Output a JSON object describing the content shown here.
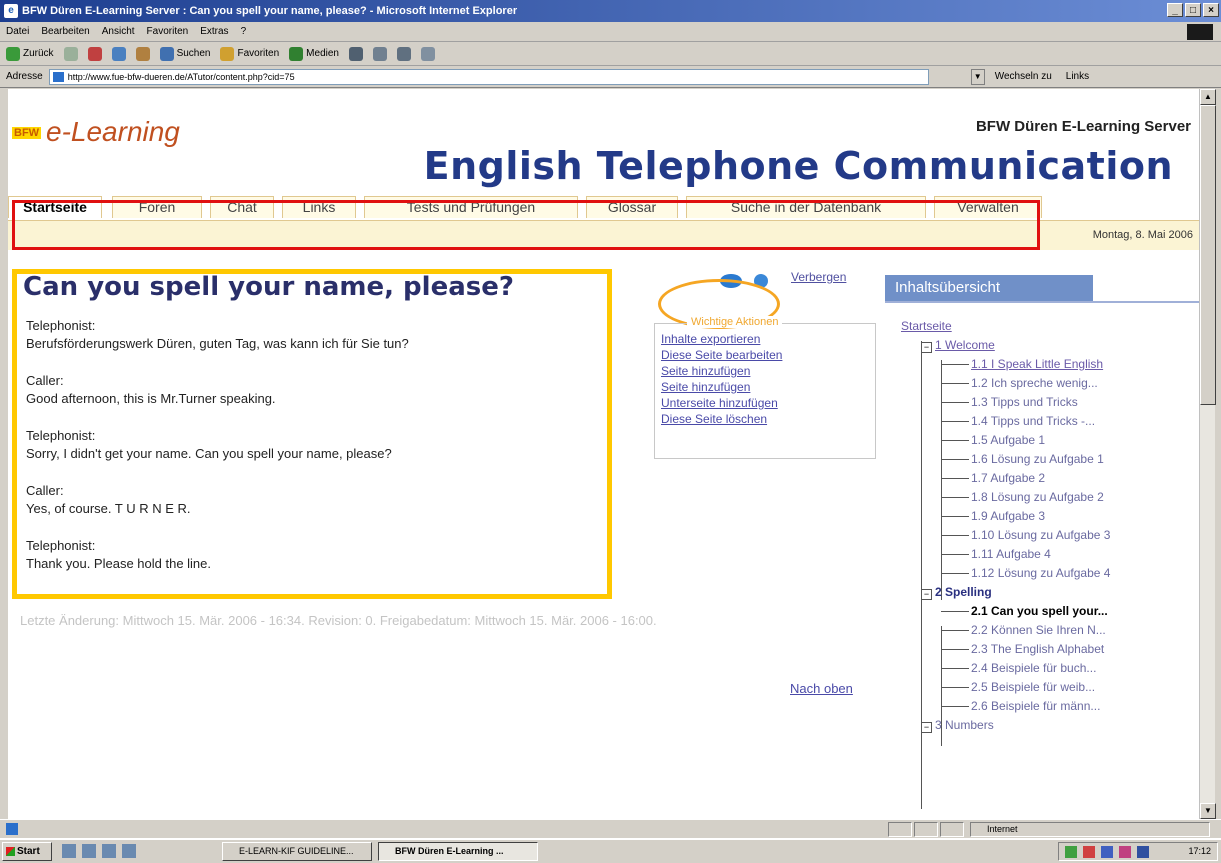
{
  "window": {
    "title": "BFW Düren E-Learning Server : Can you spell your name, please? - Microsoft Internet Explorer"
  },
  "menubar": [
    "Datei",
    "Bearbeiten",
    "Ansicht",
    "Favoriten",
    "Extras",
    "?"
  ],
  "toolbar": {
    "back": "Zurück",
    "search": "Suchen",
    "favorites": "Favoriten",
    "media": "Medien"
  },
  "addressbar": {
    "label": "Adresse",
    "url": "http://www.fue-bfw-dueren.de/ATutor/content.php?cid=75",
    "go": "Wechseln zu",
    "links": "Links"
  },
  "header": {
    "bfw_logo": "BFW",
    "elearning": "e-Learning",
    "server_title": "BFW Düren E-Learning Server",
    "course_title": "English Telephone Communication"
  },
  "nav": {
    "tabs": [
      "Startseite",
      "Foren",
      "Chat",
      "Links",
      "Tests und Prüfungen",
      "Glossar",
      "Suche in der Datenbank",
      "Verwalten"
    ],
    "date": "Montag, 8. Mai 2006"
  },
  "content": {
    "heading": "Can you spell your name, please?",
    "dialog": [
      {
        "speaker": "Telephonist:",
        "text": "Berufsförderungswerk Düren, guten Tag, was kann ich für Sie tun?"
      },
      {
        "speaker": "Caller:",
        "text": "Good afternoon, this is Mr.Turner speaking."
      },
      {
        "speaker": "Telephonist:",
        "text": "Sorry, I didn't get your name. Can you spell your name, please?"
      },
      {
        "speaker": "Caller:",
        "text": "Yes, of course. T U R N E R."
      },
      {
        "speaker": "Telephonist:",
        "text": "Thank you. Please hold the line."
      }
    ],
    "last_change": "Letzte Änderung: Mittwoch 15. Mär. 2006 - 16:34. Revision: 0. Freigabedatum: Mittwoch 15. Mär. 2006 - 16:00.",
    "top_link": "Nach oben"
  },
  "tools": {
    "hide": "Verbergen"
  },
  "actions": {
    "title": "Wichtige Aktionen",
    "items": [
      "Inhalte exportieren",
      "Diese Seite bearbeiten",
      "Seite hinzufügen",
      "Seite hinzufügen",
      "Unterseite hinzufügen",
      "Diese Seite löschen"
    ]
  },
  "toc": {
    "title": "Inhaltsübersicht",
    "home": "Startseite",
    "ch1": "1 Welcome",
    "ch1_items": [
      "1.1 I Speak Little English",
      "1.2 Ich spreche wenig...",
      "1.3 Tipps und Tricks",
      "1.4 Tipps und Tricks -...",
      "1.5 Aufgabe 1",
      "1.6 Lösung zu Aufgabe 1",
      "1.7 Aufgabe 2",
      "1.8 Lösung zu Aufgabe 2",
      "1.9 Aufgabe 3",
      "1.10 Lösung zu Aufgabe 3",
      "1.11 Aufgabe 4",
      "1.12 Lösung zu Aufgabe 4"
    ],
    "ch2": "2 Spelling",
    "ch2_items": [
      "2.1 Can you spell your...",
      "2.2 Können Sie Ihren N...",
      "2.3 The English Alphabet",
      "2.4 Beispiele für buch...",
      "2.5 Beispiele für weib...",
      "2.6 Beispiele für männ..."
    ],
    "ch3": "3 Numbers"
  },
  "statusbar": {
    "zone": "Internet"
  },
  "taskbar": {
    "start": "Start",
    "tasks": [
      "E-LEARN-KIF GUIDELINE...",
      "BFW Düren E-Learning ..."
    ],
    "clock": "17:12"
  }
}
